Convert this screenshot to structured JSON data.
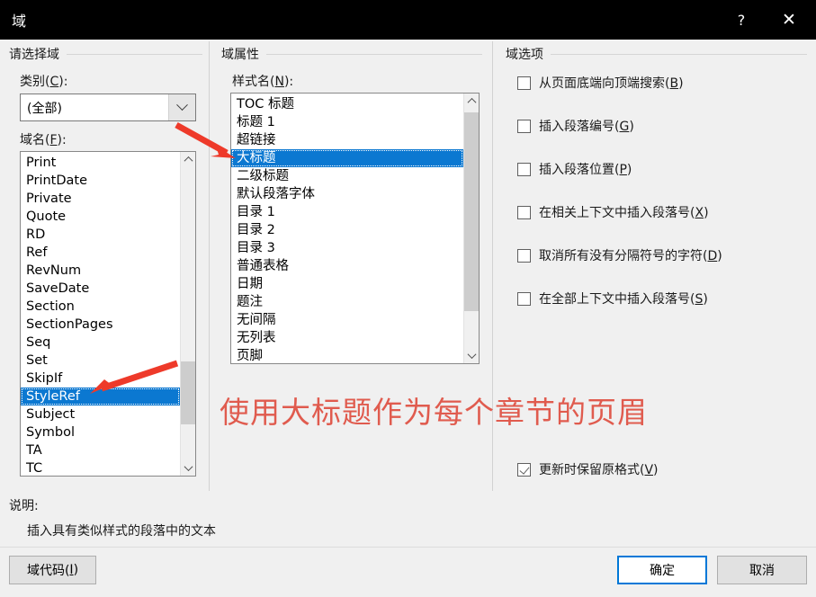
{
  "window": {
    "title": "域",
    "help_label": "?",
    "close_label": "✕"
  },
  "left_panel": {
    "group_title": "请选择域",
    "category_label_prefix": "类别(",
    "category_label_key": "C",
    "category_label_suffix": "):",
    "category_value": "(全部)",
    "fieldname_label_prefix": "域名(",
    "fieldname_label_key": "F",
    "fieldname_label_suffix": "):",
    "field_names": [
      "Print",
      "PrintDate",
      "Private",
      "Quote",
      "RD",
      "Ref",
      "RevNum",
      "SaveDate",
      "Section",
      "SectionPages",
      "Seq",
      "Set",
      "SkipIf",
      "StyleRef",
      "Subject",
      "Symbol",
      "TA",
      "TC"
    ],
    "selected_field": "StyleRef"
  },
  "middle_panel": {
    "group_title": "域属性",
    "stylename_label_prefix": "样式名(",
    "stylename_label_key": "N",
    "stylename_label_suffix": "):",
    "style_names": [
      "TOC 标题",
      "标题 1",
      "超链接",
      "大标题",
      "二级标题",
      "默认段落字体",
      "目录 1",
      "目录 2",
      "目录 3",
      "普通表格",
      "日期",
      "题注",
      "无间隔",
      "无列表",
      "页脚"
    ],
    "selected_style": "大标题"
  },
  "right_panel": {
    "group_title": "域选项",
    "options": [
      {
        "label_prefix": "从页面底端向顶端搜索(",
        "key": "B",
        "label_suffix": ")",
        "checked": false
      },
      {
        "label_prefix": "插入段落编号(",
        "key": "G",
        "label_suffix": ")",
        "checked": false
      },
      {
        "label_prefix": "插入段落位置(",
        "key": "P",
        "label_suffix": ")",
        "checked": false
      },
      {
        "label_prefix": "在相关上下文中插入段落号(",
        "key": "X",
        "label_suffix": ")",
        "checked": false
      },
      {
        "label_prefix": "取消所有没有分隔符号的字符(",
        "key": "D",
        "label_suffix": ")",
        "checked": false
      },
      {
        "label_prefix": "在全部上下文中插入段落号(",
        "key": "S",
        "label_suffix": ")",
        "checked": false
      }
    ],
    "preserve_format": {
      "label_prefix": "更新时保留原格式(",
      "key": "V",
      "label_suffix": ")",
      "checked": true
    }
  },
  "description": {
    "label": "说明:",
    "text": "插入具有类似样式的段落中的文本"
  },
  "footer": {
    "fieldcodes_prefix": "域代码(",
    "fieldcodes_key": "I",
    "fieldcodes_suffix": ")",
    "ok_label": "确定",
    "cancel_label": "取消"
  },
  "annotation": {
    "text": "使用大标题作为每个章节的页眉",
    "color": "#e05b4e",
    "arrow_color": "#ee3a2a"
  },
  "colors": {
    "selection_blue": "#0b78d1",
    "accent_blue": "#0078d7",
    "dialog_bg": "#f0f0f0",
    "titlebar_bg": "#000000"
  }
}
